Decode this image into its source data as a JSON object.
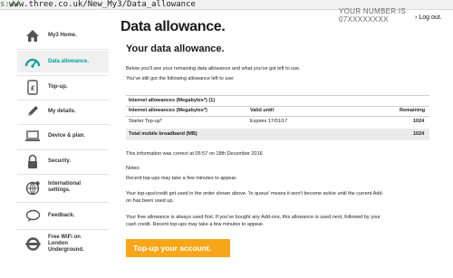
{
  "browser": {
    "url_scheme": "s://",
    "url_rest": "www.three.co.uk/New_My3/Data_allowance",
    "cut_text": "YOUR NUMBER IS 07XXXXXXXX"
  },
  "header": {
    "logout": "Log out."
  },
  "sidebar": {
    "items": [
      {
        "label": "My3 Home.",
        "icon": "home-icon"
      },
      {
        "label": "Data allowance.",
        "icon": "gauge-icon",
        "active": true
      },
      {
        "label": "Top-up.",
        "icon": "topup-phone-icon"
      },
      {
        "label": "My details.",
        "icon": "pencil-icon"
      },
      {
        "label": "Device & plan.",
        "icon": "laptop-icon"
      },
      {
        "label": "Security.",
        "icon": "lock-icon"
      },
      {
        "label": "International settings.",
        "icon": "globe-icon"
      },
      {
        "label": "Feedback.",
        "icon": "speech-bubble-icon"
      },
      {
        "label": "Free WiFi on London Underground.",
        "icon": "underground-icon"
      }
    ]
  },
  "main": {
    "title": "Data allowance.",
    "subtitle": "Your data allowance.",
    "intro": "Below you'll see your remaining data allowance and what you've got left to use.",
    "still_got": "You've still got the following allowance left to use:",
    "table": {
      "section": "Internet allowances (Megabytes*) (1)",
      "headers": [
        "Internet allowances (Megabytes*)",
        "Valid until",
        "Remaining"
      ],
      "rows": [
        {
          "name": "Starter Top-up*",
          "valid": "Expires 17/01/17",
          "remaining": "1024"
        }
      ],
      "total_label": "Total mobile broadband (MB)",
      "total_value": "1024"
    },
    "correct_at": "This information was correct at 05:57 on 18th December 2016",
    "notes_title": "Notes:",
    "note1": "Recent top-ups may take a few minutes to appear.",
    "note2_l1": "Your top-ups/credit get used in the order shown above. 'In queue' means it won't become active until the current Add-",
    "note2_l2": "on has been used up.",
    "note3_l1": "Your free allowance is always used first. If you've bought any Add-ons, this allowance is used next, followed by your",
    "note3_l2": "cash credit. Recent top-ups may take a few minutes to appear.",
    "button": "Top-up your account."
  },
  "colors": {
    "accent_teal": "#00a19a",
    "button_orange": "#f7a619"
  }
}
